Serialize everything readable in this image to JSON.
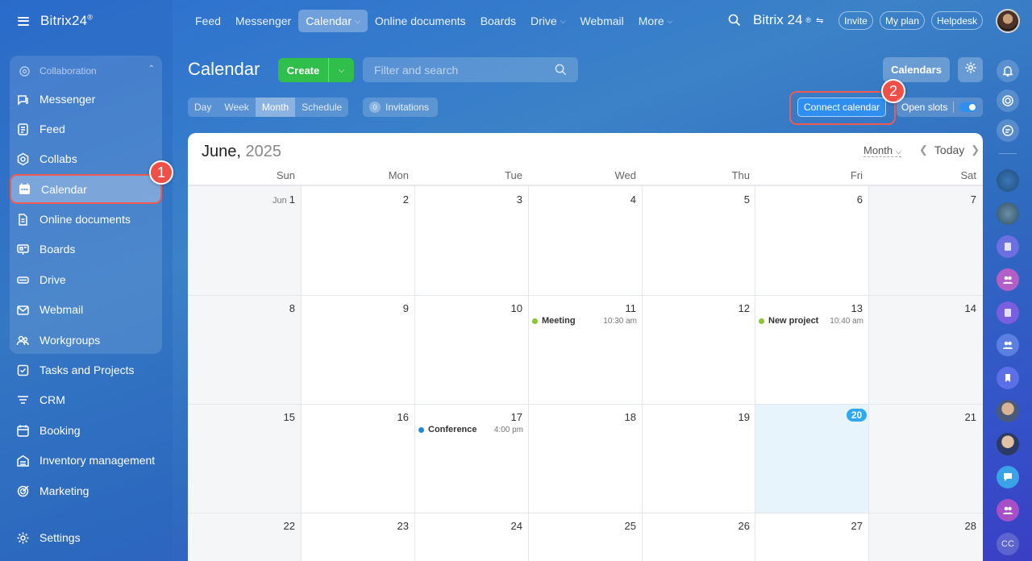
{
  "app": {
    "logo": "Bitrix24",
    "logo_mark": "®"
  },
  "topnav": [
    {
      "label": "Feed"
    },
    {
      "label": "Messenger"
    },
    {
      "label": "Calendar"
    },
    {
      "label": "Online documents"
    },
    {
      "label": "Boards"
    },
    {
      "label": "Drive"
    },
    {
      "label": "Webmail"
    },
    {
      "label": "More"
    }
  ],
  "header_right": {
    "brand": "Bitrix 24",
    "invite": "Invite",
    "plan": "My plan",
    "helpdesk": "Helpdesk"
  },
  "sidebar": {
    "group_title": "Collaboration",
    "items": [
      {
        "label": "Messenger",
        "icon": "messenger-icon"
      },
      {
        "label": "Feed",
        "icon": "feed-icon"
      },
      {
        "label": "Collabs",
        "icon": "collabs-icon"
      },
      {
        "label": "Calendar",
        "icon": "calendar-icon"
      },
      {
        "label": "Online documents",
        "icon": "document-icon"
      },
      {
        "label": "Boards",
        "icon": "boards-icon"
      },
      {
        "label": "Drive",
        "icon": "drive-icon"
      },
      {
        "label": "Webmail",
        "icon": "mail-icon"
      },
      {
        "label": "Workgroups",
        "icon": "workgroups-icon"
      },
      {
        "label": "Tasks and Projects",
        "icon": "tasks-icon"
      },
      {
        "label": "CRM",
        "icon": "crm-icon"
      },
      {
        "label": "Booking",
        "icon": "booking-icon"
      },
      {
        "label": "Inventory management",
        "icon": "inventory-icon"
      },
      {
        "label": "Marketing",
        "icon": "marketing-icon"
      }
    ],
    "settings": "Settings"
  },
  "markers": {
    "one": "1",
    "two": "2"
  },
  "page": {
    "title": "Calendar",
    "create": "Create",
    "filter_placeholder": "Filter and search",
    "calendars_btn": "Calendars",
    "views": [
      "Day",
      "Week",
      "Month",
      "Schedule"
    ],
    "selected_view": "Month",
    "invitations_count": "0",
    "invitations_label": "Invitations",
    "connect": "Connect calendar",
    "open_slots": "Open slots"
  },
  "calendar": {
    "month": "June,",
    "year": "2025",
    "mode": "Month",
    "today_label": "Today",
    "days_of_week": [
      "Sun",
      "Mon",
      "Tue",
      "Wed",
      "Thu",
      "Fri",
      "Sat"
    ],
    "first_month_label": "Jun",
    "weeks": [
      [
        "1",
        "2",
        "3",
        "4",
        "5",
        "6",
        "7"
      ],
      [
        "8",
        "9",
        "10",
        "11",
        "12",
        "13",
        "14"
      ],
      [
        "15",
        "16",
        "17",
        "18",
        "19",
        "20",
        "21"
      ],
      [
        "22",
        "23",
        "24",
        "25",
        "26",
        "27",
        "28"
      ]
    ],
    "today": "20",
    "events": [
      {
        "name": "Meeting",
        "time": "10:30 am",
        "color": "#8ac532"
      },
      {
        "name": "New project",
        "time": "10:40 am",
        "color": "#8ac532"
      },
      {
        "name": "Conference",
        "time": "4:00 pm",
        "color": "#2389d7"
      }
    ]
  },
  "rail": {
    "last_initials": "CC"
  },
  "colors": {
    "accent": "#2f8ff0",
    "create": "#2fbf4a",
    "highlight": "#ef5a52",
    "today": "#2fa8f0"
  }
}
